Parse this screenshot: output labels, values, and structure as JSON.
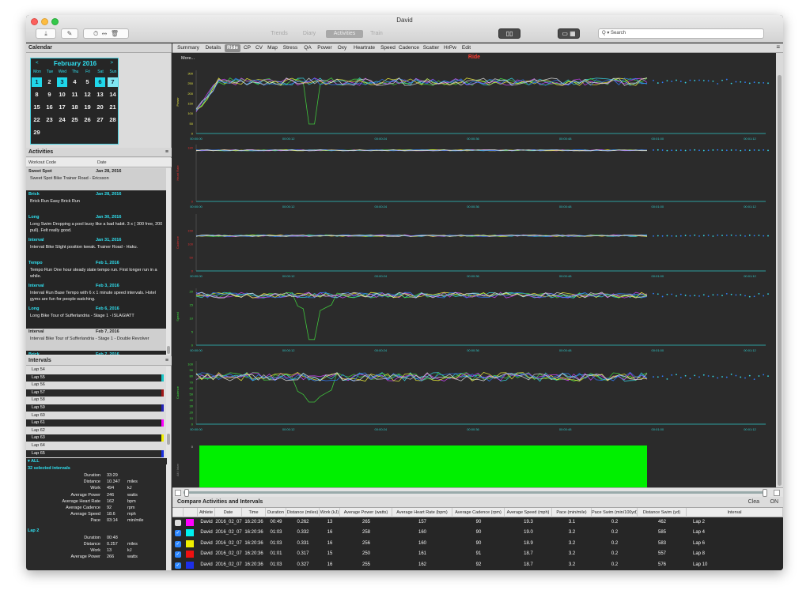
{
  "window": {
    "title": "David"
  },
  "toolbar": {
    "buttons": [
      "download-icon",
      "edit-icon",
      "stopwatch-icon",
      "split-icon",
      "trash-icon"
    ],
    "glyphs": [
      "⤓",
      "✎",
      "⏱",
      "⇹",
      "🗑"
    ],
    "views": [
      "Trends",
      "Diary",
      "Activities",
      "Train"
    ],
    "active_view": "Activities",
    "search_placeholder": "Q ▾ Search"
  },
  "calendar": {
    "title": "Calendar",
    "month": "February 2016",
    "prev": "<",
    "next": ">",
    "dow": [
      "Mon",
      "Tue",
      "Wed",
      "Thu",
      "Fri",
      "Sat",
      "Sun"
    ],
    "weeks": [
      [
        "1",
        "2",
        "3",
        "4",
        "5",
        "6",
        "7"
      ],
      [
        "8",
        "9",
        "10",
        "11",
        "12",
        "13",
        "14"
      ],
      [
        "15",
        "16",
        "17",
        "18",
        "19",
        "20",
        "21"
      ],
      [
        "22",
        "23",
        "24",
        "25",
        "26",
        "27",
        "28"
      ],
      [
        "29",
        "",
        "",
        "",
        "",
        "",
        ""
      ]
    ],
    "highlighted": [
      "1",
      "3",
      "6"
    ],
    "highlighted_light": [
      "7"
    ]
  },
  "activities": {
    "title": "Activities",
    "col_code": "Workout Code",
    "col_date": "Date",
    "items": [
      {
        "code": "Sweet Spot",
        "date": "Jan 28, 2016",
        "desc": "Sweet Spot Bike Trainer Road - Ericsson",
        "selected": true
      },
      {
        "code": "Brick",
        "date": "Jan 28, 2016",
        "desc": "Brick Run Easy Brick Run",
        "selected": false
      },
      {
        "code": "Long",
        "date": "Jan 30, 2016",
        "desc": "Long Swim Dropping a pool buoy like a bad habit. 3 x ( 300 free, 200 pull). Felt really good.",
        "selected": false
      },
      {
        "code": "Interval",
        "date": "Jan 31, 2016",
        "desc": "Interval Bike Slight position tweak. Trainer Road - Haku.",
        "selected": false
      },
      {
        "code": "Tempo",
        "date": "Feb 1, 2016",
        "desc": "Tempo Run One hour steady state tempo run. First longer run in a while.",
        "selected": false
      },
      {
        "code": "Interval",
        "date": "Feb 3, 2016",
        "desc": "Interval Run Base Tempo with 6 x 1 minute speed intervals. Hotel gyms are fun for people watching.",
        "selected": false
      },
      {
        "code": "Long",
        "date": "Feb 6, 2016",
        "desc": "Long Bike Tour of Sufferlandria - Stage 1 - ISLAGIATT",
        "selected": false
      },
      {
        "code": "Interval",
        "date": "Feb 7, 2016",
        "desc": "Interval Bike Tour of Sufferlandria - Stage 1 - Double Revolver",
        "selected": true
      },
      {
        "code": "Brick",
        "date": "Feb 7, 2016",
        "desc": "Brick Run Post double Revolver Brick",
        "selected": false
      }
    ]
  },
  "intervals": {
    "title": "Intervals",
    "laps": [
      {
        "label": "Lap 54",
        "color": ""
      },
      {
        "label": "Lap 55",
        "color": "#18c7c7"
      },
      {
        "label": "Lap 56",
        "color": ""
      },
      {
        "label": "Lap 57",
        "color": "#a01818"
      },
      {
        "label": "Lap 58",
        "color": ""
      },
      {
        "label": "Lap 59",
        "color": "#2424b8"
      },
      {
        "label": "Lap 60",
        "color": ""
      },
      {
        "label": "Lap 61",
        "color": "#ff00ff"
      },
      {
        "label": "Lap 62",
        "color": ""
      },
      {
        "label": "Lap 63",
        "color": "#f0f000"
      },
      {
        "label": "Lap 64",
        "color": ""
      },
      {
        "label": "Lap 65",
        "color": "#1a2fe0"
      }
    ],
    "all_label": "▾ ALL"
  },
  "stats": {
    "groups": [
      {
        "title": "32 selected intervals",
        "rows": [
          {
            "label": "Duration",
            "value": "33:29",
            "unit": ""
          },
          {
            "label": "Distance",
            "value": "10.347",
            "unit": "miles"
          },
          {
            "label": "Work",
            "value": "494",
            "unit": "kJ"
          },
          {
            "label": "Average Power",
            "value": "246",
            "unit": "watts"
          },
          {
            "label": "Average Heart Rate",
            "value": "162",
            "unit": "bpm"
          },
          {
            "label": "Average Cadence",
            "value": "92",
            "unit": "rpm"
          },
          {
            "label": "Average Speed",
            "value": "18.6",
            "unit": "mph"
          },
          {
            "label": "Pace",
            "value": "03:14",
            "unit": "min/mile"
          }
        ]
      },
      {
        "title": "Lap 2",
        "rows": [
          {
            "label": "Duration",
            "value": "00:48",
            "unit": ""
          },
          {
            "label": "Distance",
            "value": "0.257",
            "unit": "miles"
          },
          {
            "label": "Work",
            "value": "13",
            "unit": "kJ"
          },
          {
            "label": "Average Power",
            "value": "266",
            "unit": "watts"
          }
        ]
      }
    ]
  },
  "tabs": [
    "Summary",
    "Details",
    "Ride",
    "CP",
    "CV",
    "Map",
    "Stress",
    "QA",
    "Power",
    "Oxy",
    "Heartrate",
    "Speed",
    "Cadence",
    "Scatter",
    "HrPw",
    "Edit"
  ],
  "active_tab": "Ride",
  "plot": {
    "more": "More...",
    "title": "Ride",
    "xticks": [
      "00:00:00",
      "00:00:12",
      "00:00:24",
      "00:00:36",
      "00:00:48",
      "00:01:00",
      "00:01:12"
    ],
    "colors": {
      "cyan": "#36d8e6",
      "green": "#43e040",
      "magenta": "#d144ff",
      "yellow": "#f0f03a",
      "blue": "#2f7dff",
      "white": "#dddddd",
      "bar_green": "#00f000",
      "axis": "#2ec7c7"
    },
    "panels": [
      {
        "ylabel": "Power",
        "yticks": [
          "300",
          "250",
          "200",
          "150",
          "100",
          "50",
          "0"
        ],
        "label_color": "#e0e040"
      },
      {
        "ylabel": "Heart Rate",
        "yticks": [
          "180",
          "",
          "",
          "",
          "",
          "",
          "0"
        ],
        "label_color": "#e03030"
      },
      {
        "ylabel": "Cadence",
        "yticks": [
          "",
          "150",
          "100",
          "50",
          "0"
        ],
        "label_color": "#e03030"
      },
      {
        "ylabel": "Speed",
        "yticks": [
          "20",
          "15",
          "10",
          "5",
          "0"
        ],
        "label_color": "#40e040"
      },
      {
        "ylabel": "Cadence",
        "yticks": [
          "100",
          "90",
          "80",
          "70",
          "60",
          "50",
          "40",
          "30",
          "20",
          "10",
          "0"
        ],
        "label_color": "#40e040"
      },
      {
        "ylabel": "Alt / Inter",
        "yticks": [
          "0",
          "",
          "",
          "",
          ""
        ],
        "label_color": "#888888"
      }
    ]
  },
  "compare": {
    "title": "Compare Activities and Intervals",
    "clear": "Clea",
    "on": "ON",
    "columns": [
      "",
      "",
      "Athlete",
      "Date",
      "Time",
      "Duration",
      "Distance (miles)",
      "Work (kJ)",
      "Average Power (watts)",
      "Average Heart Rate (bpm)",
      "Average Cadence (rpm)",
      "Average Speed (mph)",
      "Pace (min/mile)",
      "Pace Swim (min/100yd)",
      "Distance Swim (yd)",
      "Interval"
    ],
    "rows": [
      {
        "checked": false,
        "color": "#ff00ff",
        "athlete": "David",
        "date": "2016_02_07",
        "time": "16:20:36",
        "duration": "00:49",
        "distance": "0.262",
        "work": "13",
        "power": "265",
        "hr": "157",
        "cadence": "90",
        "speed": "19.3",
        "pace": "3.1",
        "pace_swim": "0.2",
        "dist_swim": "462",
        "interval": "Lap 2"
      },
      {
        "checked": true,
        "color": "#00f0f0",
        "athlete": "David",
        "date": "2016_02_07",
        "time": "16:20:36",
        "duration": "01:03",
        "distance": "0.332",
        "work": "16",
        "power": "258",
        "hr": "160",
        "cadence": "90",
        "speed": "19.0",
        "pace": "3.2",
        "pace_swim": "0.2",
        "dist_swim": "585",
        "interval": "Lap 4"
      },
      {
        "checked": true,
        "color": "#f0f000",
        "athlete": "David",
        "date": "2016_02_07",
        "time": "16:20:36",
        "duration": "01:03",
        "distance": "0.331",
        "work": "16",
        "power": "256",
        "hr": "160",
        "cadence": "90",
        "speed": "18.9",
        "pace": "3.2",
        "pace_swim": "0.2",
        "dist_swim": "583",
        "interval": "Lap 6"
      },
      {
        "checked": true,
        "color": "#ee1111",
        "athlete": "David",
        "date": "2016_02_07",
        "time": "16:20:36",
        "duration": "01:01",
        "distance": "0.317",
        "work": "15",
        "power": "250",
        "hr": "161",
        "cadence": "91",
        "speed": "18.7",
        "pace": "3.2",
        "pace_swim": "0.2",
        "dist_swim": "557",
        "interval": "Lap 8"
      },
      {
        "checked": true,
        "color": "#1d2fe8",
        "athlete": "David",
        "date": "2016_02_07",
        "time": "16:20:36",
        "duration": "01:03",
        "distance": "0.327",
        "work": "16",
        "power": "255",
        "hr": "162",
        "cadence": "92",
        "speed": "18.7",
        "pace": "3.2",
        "pace_swim": "0.2",
        "dist_swim": "576",
        "interval": "Lap 10"
      }
    ]
  },
  "bottom_icons": [
    "calendar-icon",
    "folder-icon",
    "stopwatch-icon"
  ],
  "bottom_glyphs": [
    "▦",
    "▬",
    "⏱"
  ]
}
